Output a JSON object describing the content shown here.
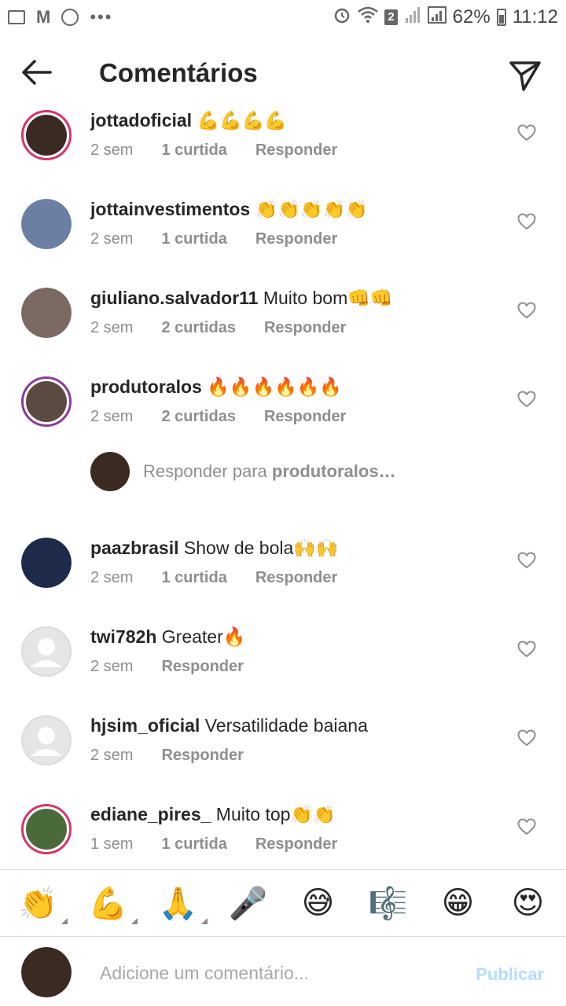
{
  "status_bar": {
    "time": "11:12",
    "battery": "62%",
    "sim_badge": "2",
    "dots": "•••",
    "mail": "M"
  },
  "header": {
    "title": "Comentários"
  },
  "comments": [
    {
      "username": "jottadoficial",
      "text": "",
      "emojis": "💪💪💪💪",
      "age": "2 sem",
      "likes": "1 curtida",
      "reply": "Responder",
      "avatar_color": "#3b2a22",
      "ring": true
    },
    {
      "username": "jottainvestimentos",
      "text": "",
      "emojis": "👏👏👏👏👏",
      "age": "2 sem",
      "likes": "1 curtida",
      "reply": "Responder",
      "avatar_color": "#6b7fa3",
      "ring": false
    },
    {
      "username": "giuliano.salvador11",
      "text": " Muito bom",
      "emojis": "👊👊",
      "age": "2 sem",
      "likes": "2 curtidas",
      "reply": "Responder",
      "avatar_color": "#7a6a62",
      "ring": false
    },
    {
      "username": "produtoralos",
      "text": " ",
      "emojis": "🔥🔥🔥🔥🔥🔥",
      "age": "2 sem",
      "likes": "2 curtidas",
      "reply": "Responder",
      "avatar_color": "#5a4a42",
      "ring": false
    },
    {
      "username": "paazbrasil",
      "text": " Show de bola",
      "emojis": "🙌🙌",
      "age": "2 sem",
      "likes": "1 curtida",
      "reply": "Responder",
      "avatar_color": "#1e2a4a",
      "ring": false
    },
    {
      "username": "twi782h",
      "text": " Greater",
      "emojis": "🔥",
      "age": "2 sem",
      "likes": "",
      "reply": "Responder",
      "avatar_color": "#dbdbdb",
      "ring": false
    },
    {
      "username": "hjsim_oficial",
      "text": " Versatilidade baiana",
      "emojis": "",
      "age": "2 sem",
      "likes": "",
      "reply": "Responder",
      "avatar_color": "#dbdbdb",
      "ring": false
    },
    {
      "username": "ediane_pires_",
      "text": " Muito top",
      "emojis": "👏👏",
      "age": "1 sem",
      "likes": "1 curtida",
      "reply": "Responder",
      "avatar_color": "#4a6a3a",
      "ring": true
    }
  ],
  "reply_prompt": {
    "prefix": "Responder para ",
    "username": "produtoralos…"
  },
  "emoji_bar": [
    "👏",
    "💪",
    "🙏",
    "🎤",
    "😅",
    "🎼",
    "😁",
    "😍"
  ],
  "compose": {
    "placeholder": "Adicione um comentário...",
    "publish_label": "Publicar"
  },
  "colors": {
    "publish": "#b3dbff",
    "meta": "#8e8e8e",
    "ring": "#d6336c"
  }
}
